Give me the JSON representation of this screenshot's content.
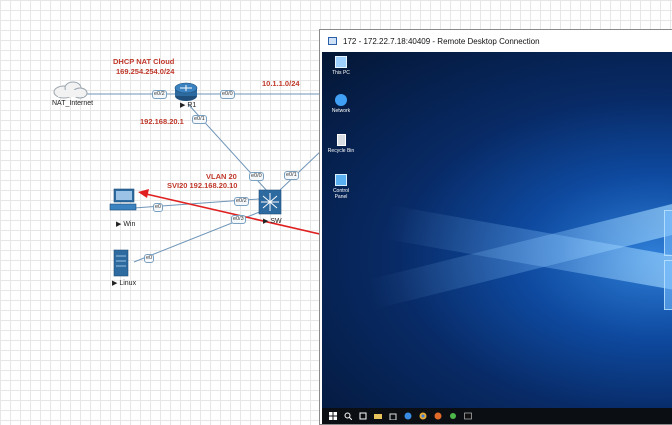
{
  "topology": {
    "cloud": {
      "name": "DHCP NAT Cloud",
      "subnet": "169.254.254.0/24"
    },
    "nat_node": {
      "label": "NAT_Internet"
    },
    "router": {
      "label": "R1",
      "port_cloud": "e0/2",
      "port_rdp": "e0/0",
      "port_switch": "e0/1",
      "subnet_rdp": "10.1.1.0/24",
      "ip_switch_link": "192.168.20.1"
    },
    "switch": {
      "label": "SW",
      "port_router": "e0/0",
      "port_rdp": "e0/1",
      "port_win": "e0/2",
      "port_linux": "e0/3"
    },
    "vlan": {
      "name": "VLAN 20",
      "svi": "SVI20 192.168.20.10"
    },
    "win_host": {
      "label": "Win",
      "port": "e0"
    },
    "linux_host": {
      "label": "Linux",
      "port": "e0"
    }
  },
  "rdp_window": {
    "title": "172 - 172.22.7.18:40409 - Remote Desktop Connection",
    "desktop_icons": [
      {
        "label": "This PC",
        "icon": "computer-icon"
      },
      {
        "label": "Network",
        "icon": "network-icon"
      },
      {
        "label": "Recycle Bin",
        "icon": "recycle-bin-icon"
      },
      {
        "label": "Control Panel",
        "icon": "control-panel-icon"
      }
    ],
    "taskbar_icons": [
      "windows-start-icon",
      "search-icon",
      "task-view-icon",
      "file-explorer-icon",
      "store-icon",
      "edge-icon",
      "chrome-icon",
      "firefox-icon",
      "settings-icon",
      "terminal-icon"
    ]
  },
  "colors": {
    "annotation": "#c0392b",
    "link": "#6f95b8",
    "arrow": "#e02020",
    "desktop_bg": "#0b3a85"
  }
}
